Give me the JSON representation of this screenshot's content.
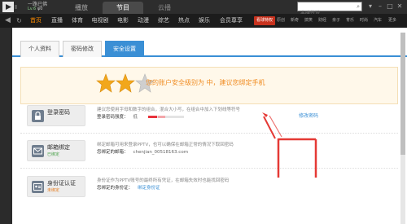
{
  "titlebar": {
    "user_name": "一路已佛",
    "user_level": "Lv.6",
    "user_coin": "ψ0",
    "tabs": [
      "播放",
      "节目",
      "云播"
    ],
    "search_placeholder": "丰碑传说",
    "window_controls": [
      "▾",
      "–",
      "□",
      "✕"
    ]
  },
  "navbar": {
    "items": [
      "首页",
      "直播",
      "体育",
      "电视剧",
      "电影",
      "动漫",
      "综艺",
      "热点",
      "娱乐",
      "会员尊享"
    ],
    "vip_badge": "看球特权",
    "right_items": [
      "原创",
      "新奇",
      "搞笑",
      "财经",
      "亲子",
      "育乐",
      "时尚",
      "汽车",
      "更多"
    ]
  },
  "sub_tabs": [
    "个人资料",
    "密码修改",
    "安全设置"
  ],
  "banner": {
    "text": "您的账户安全级别为 中，建议您绑定手机",
    "rating": 2,
    "max_rating": 3
  },
  "rows": [
    {
      "label": "登录密码",
      "sub": "",
      "desc": "建议您使用字母和数字的组合，混合大小写，在组合中加入下划线等符号",
      "value_label": "登录密码强度：",
      "value": "低",
      "link": "",
      "action": "修改密码",
      "strength": 0.45
    },
    {
      "label": "邮箱绑定",
      "sub": "已绑定",
      "desc": "绑定邮箱可用来登录PPTV，也可以确保在邮箱正常的情况下取回密码",
      "value_label": "您绑定的邮箱：",
      "value": "chenjian_00518163.com",
      "link": "",
      "action": ""
    },
    {
      "label": "身份证认证",
      "sub": "未绑定",
      "desc": "身份证作为PPTV账号的最终所有凭证，在邮箱失效时也能找回密码",
      "value_label": "您绑定的身份证：",
      "value": "",
      "link": "绑定身份证",
      "action": ""
    }
  ],
  "colors": {
    "accent_orange": "#ff8c00",
    "accent_blue": "#3a8fd5",
    "annotation_red": "#e53935",
    "star_gold": "#f2a71b"
  }
}
